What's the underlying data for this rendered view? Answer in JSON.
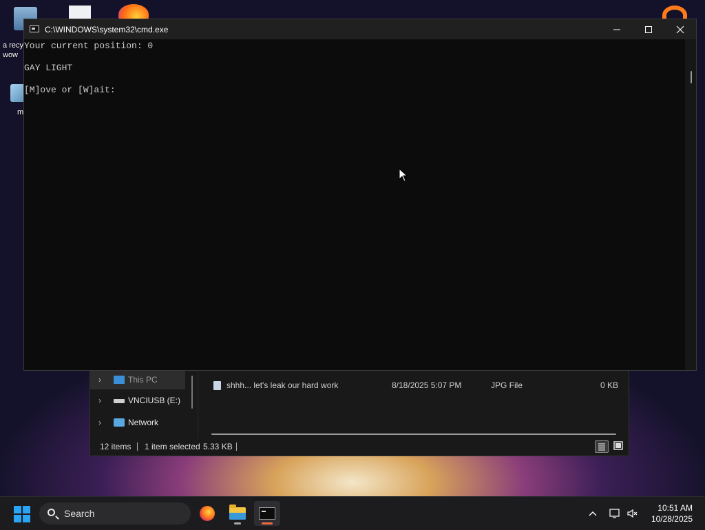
{
  "desktop": {
    "icon_labels": [
      "a recy",
      "wow",
      "m"
    ]
  },
  "explorer": {
    "nav_items": [
      {
        "label": "This PC",
        "icon": "computer-icon",
        "selected": true
      },
      {
        "label": "VNCIUSB (E:)",
        "icon": "drive-icon",
        "selected": false
      },
      {
        "label": "Network",
        "icon": "network-icon",
        "selected": false
      }
    ],
    "file": {
      "name": "shhh... let's leak our hard work",
      "date": "8/18/2025 5:07 PM",
      "type": "JPG File",
      "size": "0 KB"
    },
    "status": {
      "items": "12 items",
      "selected": "1 item selected",
      "size": "5.33 KB"
    }
  },
  "cmd": {
    "title": "C:\\WINDOWS\\system32\\cmd.exe",
    "lines": [
      "Your current position: 0",
      "GAY LIGHT",
      "[M]ove or [W]ait:"
    ],
    "minimize": "—",
    "maximize": "☐",
    "close": "✕"
  },
  "taskbar": {
    "search_label": "Search",
    "apps": [
      "firefox-icon",
      "file-explorer-icon",
      "terminal-icon"
    ],
    "time": "10:51 AM",
    "date": "10/28/2025",
    "accent": "#2aa4f4"
  }
}
